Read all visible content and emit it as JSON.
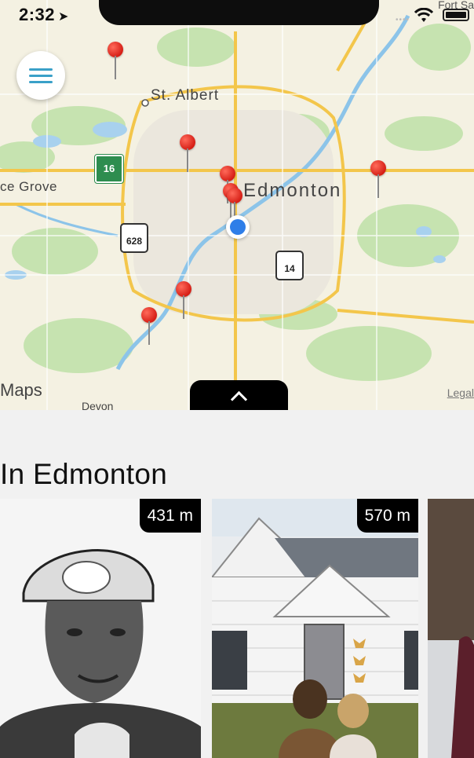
{
  "status_bar": {
    "time": "2:32",
    "location_arrow": "location-arrow-icon"
  },
  "map": {
    "corner_label": "Fort Sa",
    "labels": {
      "st_albert": "St. Albert",
      "edmonton": "Edmonton",
      "spruce_grove": "ce Grove",
      "devon": "Devon"
    },
    "highways": {
      "hwy16": "16",
      "hwy628": "628",
      "hwy14": "14"
    },
    "logo": "Maps",
    "legal": "Legal"
  },
  "section": {
    "title": "In Edmonton"
  },
  "cards": [
    {
      "distance": "431 m"
    },
    {
      "distance": "570 m"
    }
  ],
  "colors": {
    "accent": "#3aa0c8",
    "pin": "#e0281d",
    "user_location": "#2f7ee8"
  }
}
